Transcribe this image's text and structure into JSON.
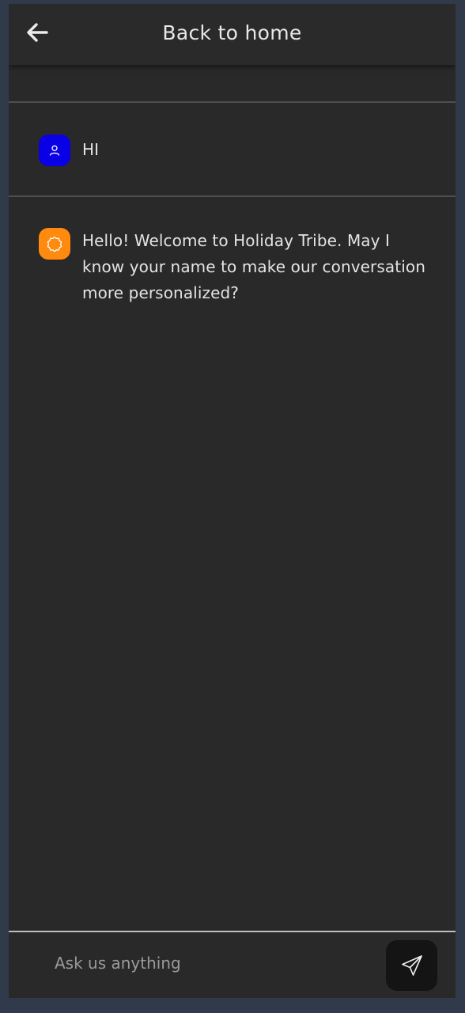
{
  "header": {
    "title": "Back to home",
    "back_icon": "arrow-left-icon"
  },
  "messages": [
    {
      "sender": "user",
      "avatar_icon": "user-icon",
      "avatar_color": "#0a00e6",
      "text": "HI"
    },
    {
      "sender": "bot",
      "avatar_icon": "bot-badge-icon",
      "avatar_color": "#ff8a0d",
      "text": "Hello! Welcome to Holiday Tribe. May I know your name to make our conversation more personalized?"
    }
  ],
  "composer": {
    "placeholder": "Ask us anything",
    "value": "",
    "send_icon": "send-icon"
  },
  "colors": {
    "page_background": "#313a4b",
    "panel_background": "#292929",
    "send_button": "#141414"
  }
}
